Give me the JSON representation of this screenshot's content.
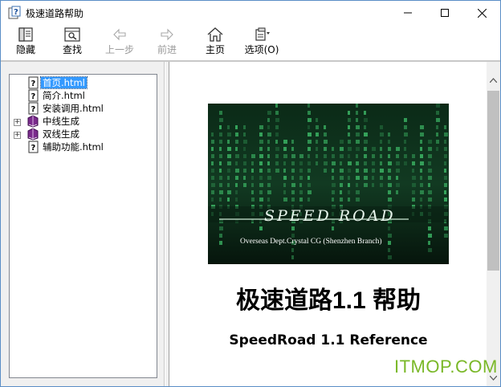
{
  "window": {
    "title": "极速道路帮助",
    "controls": {
      "minimize": "minimize-icon",
      "maximize": "maximize-icon",
      "close": "close-icon"
    }
  },
  "toolbar": {
    "hide_label": "隐藏",
    "find_label": "查找",
    "back_label": "上一步",
    "forward_label": "前进",
    "home_label": "主页",
    "options_label": "选项(O)"
  },
  "tree": {
    "items": [
      {
        "label": "首页.html",
        "icon": "help-page-icon",
        "selected": true
      },
      {
        "label": "简介.html",
        "icon": "help-page-icon"
      },
      {
        "label": "安装调用.html",
        "icon": "help-page-icon"
      },
      {
        "label": "中线生成",
        "icon": "book-icon",
        "expandable": true
      },
      {
        "label": "双线生成",
        "icon": "book-icon",
        "expandable": true
      },
      {
        "label": "辅助功能.html",
        "icon": "help-page-icon"
      }
    ]
  },
  "content": {
    "banner": {
      "logo_text": "SPEED ROAD",
      "subtitle": "Overseas Dept.Crystal CG (Shenzhen Branch)"
    },
    "title": "极速道路1.1 帮助",
    "subtitle": "SpeedRoad 1.1 Reference"
  },
  "watermark": "ITMOP.COM",
  "colors": {
    "selection": "#3399ff",
    "banner_bg": "#050d09",
    "matrix_green": "#3fbf6a",
    "watermark": "#7ab828"
  }
}
